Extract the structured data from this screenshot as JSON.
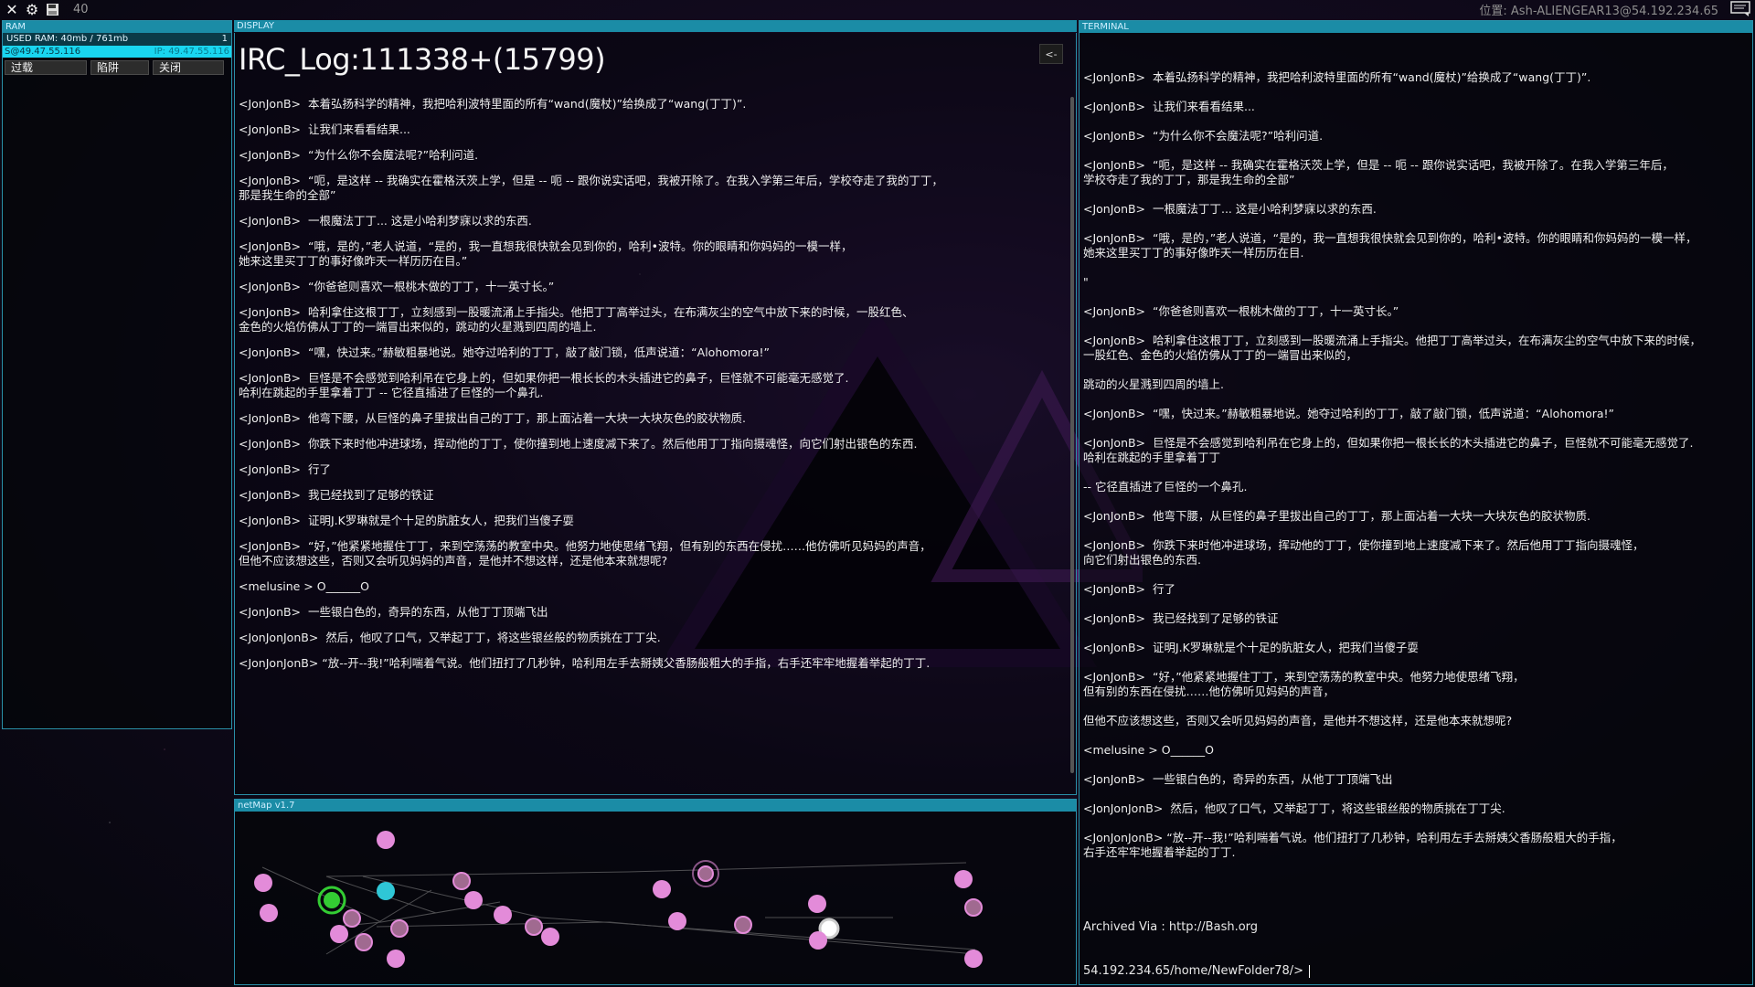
{
  "topbar": {
    "close_icon": "close-icon",
    "settings_icon": "gear-icon",
    "save_icon": "save-icon",
    "count": "40",
    "location": "位置: Ash-ALIENGEAR13@54.192.234.65"
  },
  "ram": {
    "header": "RAM",
    "used": "USED RAM: 40mb / 761mb",
    "used_count": "1",
    "bar_left": "S@49.47.55.116",
    "bar_right": "IP: 49.47.55.116",
    "buttons": [
      "过载",
      "陷阱",
      "关闭"
    ]
  },
  "display": {
    "header": "DISPLAY",
    "title": "IRC_Log:111338+(15799)",
    "back_label": "<-",
    "lines": [
      "<JonJonB>  本着弘扬科学的精神，我把哈利波特里面的所有“wand(魔杖)”给换成了“wang(丁丁)”.",
      "<JonJonB>  让我们来看看结果...",
      "<JonJonB>  “为什么你不会魔法呢?”哈利问道.",
      "<JonJonB>  “呃，是这样 -- 我确实在霍格沃茨上学，但是 -- 呃 -- 跟你说实话吧，我被开除了。在我入学第三年后，学校夺走了我的丁丁，\n那是我生命的全部”",
      "<JonJonB>  一根魔法丁丁... 这是小哈利梦寐以求的东西.",
      "<JonJonB>  “哦，是的，”老人说道，“是的，我一直想我很快就会见到你的，哈利•波特。你的眼睛和你妈妈的一模一样，\n她来这里买丁丁的事好像昨天一样历历在目。”",
      "<JonJonB>  “你爸爸则喜欢一根桃木做的丁丁，十一英寸长。”",
      "<JonJonB>  哈利拿住这根丁丁，立刻感到一股暖流涌上手指尖。他把丁丁高举过头，在布满灰尘的空气中放下来的时候，一股红色、\n金色的火焰仿佛从丁丁的一端冒出来似的，跳动的火星溅到四周的墙上.",
      "<JonJonB>  “嘿，快过来。”赫敏粗暴地说。她夺过哈利的丁丁，敲了敲门锁，低声说道：“Alohomora!”",
      "<JonJonB>  巨怪是不会感觉到哈利吊在它身上的，但如果你把一根长长的木头插进它的鼻子，巨怪就不可能毫无感觉了.\n哈利在跳起的手里拿着丁丁 -- 它径直插进了巨怪的一个鼻孔.",
      "<JonJonB>  他弯下腰，从巨怪的鼻子里拔出自己的丁丁，那上面沾着一大块一大块灰色的胶状物质.",
      "<JonJonB>  你跌下来时他冲进球场，挥动他的丁丁，使你撞到地上速度减下来了。然后他用丁丁指向摄魂怪，向它们射出银色的东西.",
      "<JonJonB>  行了",
      "<JonJonB>  我已经找到了足够的铁证",
      "<JonJonB>  证明J.K罗琳就是个十足的肮脏女人，把我们当傻子耍",
      "<JonJonB>  “好，”他紧紧地握住丁丁，来到空荡荡的教室中央。他努力地使思绪飞翔，但有别的东西在侵扰……他仿佛听见妈妈的声音，\n但他不应该想这些，否则又会听见妈妈的声音，是他并不想这样，还是他本来就想呢?",
      "<melusine > O______O",
      "<JonJonB>  一些银白色的，奇异的东西，从他丁丁顶端飞出",
      "<JonJonJonB>  然后，他叹了口气，又举起丁丁，将这些银丝般的物质挑在丁丁尖.",
      "<JonJonJonB> “放--开--我!”哈利喘着气说。他们扭打了几秒钟，哈利用左手去掰姨父香肠般粗大的手指，右手还牢牢地握着举起的丁丁."
    ]
  },
  "netmap": {
    "header": "netMap v1.7"
  },
  "terminal": {
    "header": "TERMINAL",
    "lines": [
      "<JonJonB>  本着弘扬科学的精神，我把哈利波特里面的所有“wand(魔杖)”给换成了“wang(丁丁)”.",
      "<JonJonB>  让我们来看看结果...",
      "<JonJonB>  “为什么你不会魔法呢?”哈利问道.",
      "<JonJonB>  “呃，是这样 -- 我确实在霍格沃茨上学，但是 -- 呃 -- 跟你说实话吧，我被开除了。在我入学第三年后，\n学校夺走了我的丁丁，那是我生命的全部”",
      "<JonJonB>  一根魔法丁丁... 这是小哈利梦寐以求的东西.",
      "<JonJonB>  “哦，是的，”老人说道，“是的，我一直想我很快就会见到你的，哈利•波特。你的眼睛和你妈妈的一模一样，\n她来这里买丁丁的事好像昨天一样历历在目.",
      "\"",
      "<JonJonB>  “你爸爸则喜欢一根桃木做的丁丁，十一英寸长。”",
      "<JonJonB>  哈利拿住这根丁丁，立刻感到一股暖流涌上手指尖。他把丁丁高举过头，在布满灰尘的空气中放下来的时候，\n一股红色、金色的火焰仿佛从丁丁的一端冒出来似的，",
      "跳动的火星溅到四周的墙上.",
      "<JonJonB>  “嘿，快过来。”赫敏粗暴地说。她夺过哈利的丁丁，敲了敲门锁，低声说道：“Alohomora!”",
      "<JonJonB>  巨怪是不会感觉到哈利吊在它身上的，但如果你把一根长长的木头插进它的鼻子，巨怪就不可能毫无感觉了.\n哈利在跳起的手里拿着丁丁",
      "-- 它径直插进了巨怪的一个鼻孔.",
      "<JonJonB>  他弯下腰，从巨怪的鼻子里拔出自己的丁丁，那上面沾着一大块一大块灰色的胶状物质.",
      "<JonJonB>  你跌下来时他冲进球场，挥动他的丁丁，使你撞到地上速度减下来了。然后他用丁丁指向摄魂怪，\n向它们射出银色的东西.",
      "<JonJonB>  行了",
      "<JonJonB>  我已经找到了足够的铁证",
      "<JonJonB>  证明J.K罗琳就是个十足的肮脏女人，把我们当傻子耍",
      "<JonJonB>  “好，”他紧紧地握住丁丁，来到空荡荡的教室中央。他努力地使思绪飞翔，\n但有别的东西在侵扰……他仿佛听见妈妈的声音，",
      "但他不应该想这些，否则又会听见妈妈的声音，是他并不想这样，还是他本来就想呢?",
      "<melusine > O______O",
      "<JonJonB>  一些银白色的，奇异的东西，从他丁丁顶端飞出",
      "<JonJonJonB>  然后，他叹了口气，又举起丁丁，将这些银丝般的物质挑在丁丁尖.",
      "<JonJonJonB> “放--开--我!”哈利喘着气说。他们扭打了几秒钟，哈利用左手去掰姨父香肠般粗大的手指，\n右手还牢牢地握着举起的丁丁."
    ],
    "archived": "Archived Via : http://Bash.org",
    "prompt": "54.192.234.65/home/NewFolder78/>"
  },
  "colors": {
    "accent": "#1b8ca6",
    "node_pink": "#e38bd9",
    "node_cyan": "#2fc7d6",
    "node_green": "#33cc33"
  }
}
